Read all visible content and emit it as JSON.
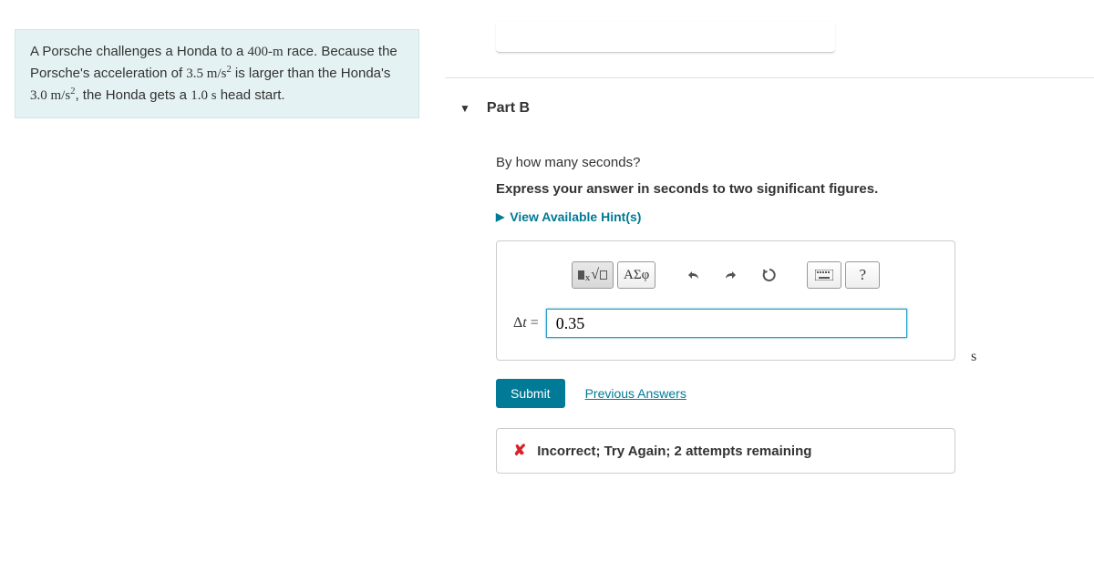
{
  "problem": {
    "text_part1": "A Porsche challenges a Honda to a ",
    "distance": "400-m",
    "text_part2": " race. Because the Porsche's acceleration of ",
    "accel1": "3.5 m/s",
    "accel1_sup": "2",
    "text_part3": " is larger than the Honda's ",
    "accel2": "3.0 m/s",
    "accel2_sup": "2",
    "text_part4": ", the Honda gets a ",
    "headstart": "1.0 s",
    "text_part5": " head start."
  },
  "part": {
    "label": "Part B",
    "question": "By how many seconds?",
    "instruction": "Express your answer in seconds to two significant figures.",
    "hints_label": "View Available Hint(s)"
  },
  "toolbar": {
    "sqrt_icon": "■ᵪ√☐",
    "greek_icon": "ΑΣφ",
    "help_icon": "?"
  },
  "answer": {
    "label": "Δt",
    "equals": " = ",
    "value": "0.35",
    "unit": "s"
  },
  "buttons": {
    "submit": "Submit",
    "prev": "Previous Answers"
  },
  "feedback": {
    "x": "✘",
    "text": "Incorrect; Try Again; 2 attempts remaining"
  }
}
